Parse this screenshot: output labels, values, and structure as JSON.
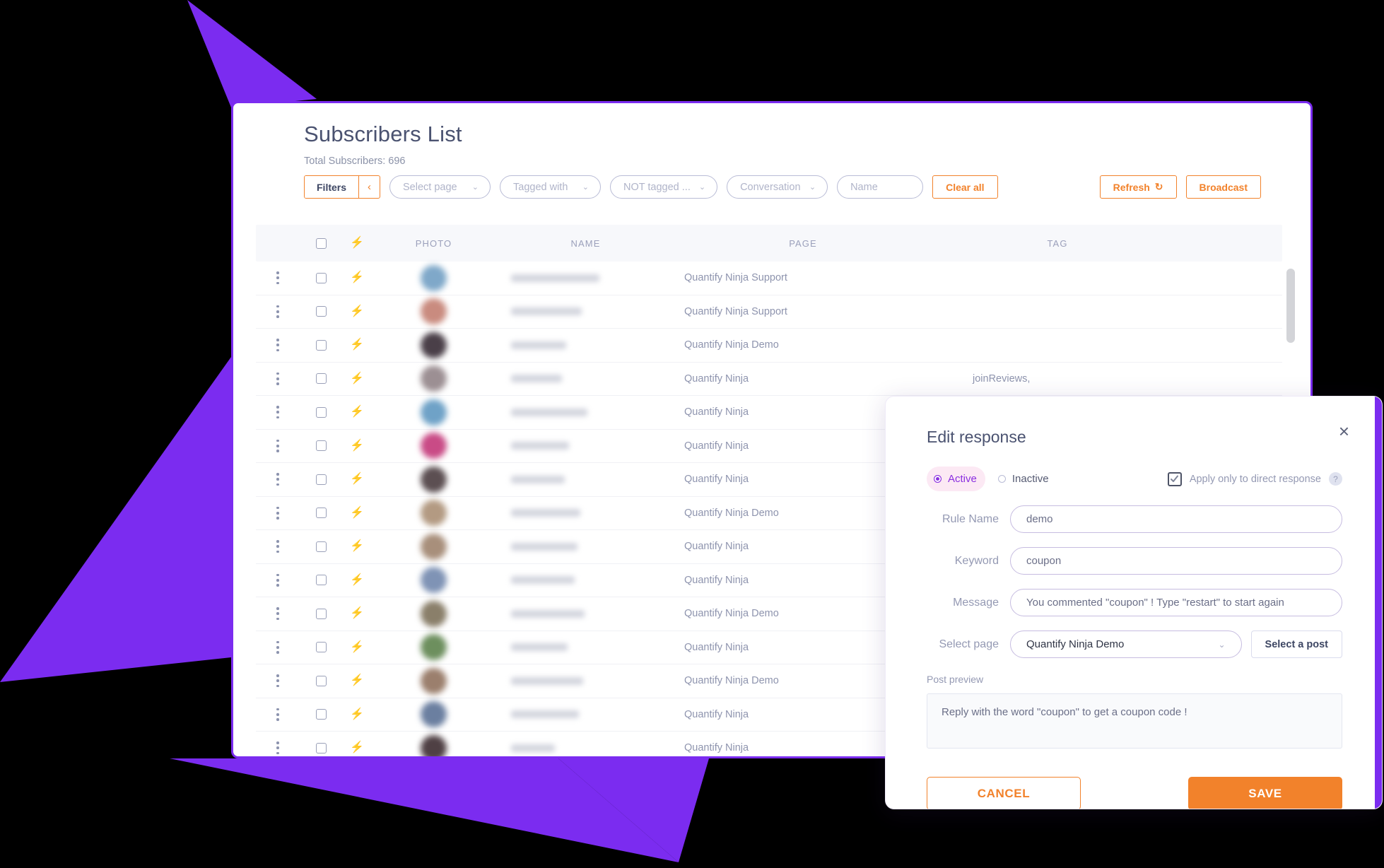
{
  "theme": {
    "accent_purple": "#7B2CF0",
    "accent_orange": "#F2822B",
    "radio_purple": "#8B2FE0",
    "background": "#000000"
  },
  "page": {
    "title": "Subscribers List",
    "total_subscribers_label": "Total Subscribers: 696"
  },
  "toolbar": {
    "filters_label": "Filters",
    "collapse_icon": "‹",
    "select_page_placeholder": "Select page",
    "tagged_with_placeholder": "Tagged with",
    "not_tagged_placeholder": "NOT tagged ...",
    "conversation_placeholder": "Conversation",
    "name_placeholder": "Name",
    "clear_all_label": "Clear all",
    "refresh_label": "Refresh",
    "refresh_icon": "↻",
    "broadcast_label": "Broadcast",
    "chevron": "⌄"
  },
  "table": {
    "columns": [
      "PHOTO",
      "NAME",
      "PAGE",
      "TAG"
    ],
    "rows": [
      {
        "page": "Quantify Ninja Support",
        "tag": "",
        "name_width": 125
      },
      {
        "page": "Quantify Ninja Support",
        "tag": "",
        "name_width": 100
      },
      {
        "page": "Quantify Ninja Demo",
        "tag": "",
        "name_width": 78
      },
      {
        "page": "Quantify Ninja",
        "tag": "joinReviews,",
        "name_width": 72
      },
      {
        "page": "Quantify Ninja",
        "tag": "",
        "name_width": 108
      },
      {
        "page": "Quantify Ninja",
        "tag": "",
        "name_width": 82
      },
      {
        "page": "Quantify Ninja",
        "tag": "",
        "name_width": 76
      },
      {
        "page": "Quantify Ninja Demo",
        "tag": "",
        "name_width": 98
      },
      {
        "page": "Quantify Ninja",
        "tag": "",
        "name_width": 94
      },
      {
        "page": "Quantify Ninja",
        "tag": "",
        "name_width": 90
      },
      {
        "page": "Quantify Ninja Demo",
        "tag": "",
        "name_width": 104
      },
      {
        "page": "Quantify Ninja",
        "tag": "",
        "name_width": 80
      },
      {
        "page": "Quantify Ninja Demo",
        "tag": "",
        "name_width": 102
      },
      {
        "page": "Quantify Ninja",
        "tag": "",
        "name_width": 96
      },
      {
        "page": "Quantify Ninja",
        "tag": "",
        "name_width": 62
      }
    ]
  },
  "modal": {
    "title": "Edit response",
    "close_icon": "×",
    "status": {
      "active_label": "Active",
      "inactive_label": "Inactive",
      "selected": "Active"
    },
    "apply_direct": {
      "label": "Apply only to direct response",
      "checked": true,
      "help_icon": "?"
    },
    "fields": {
      "rule_name_label": "Rule Name",
      "rule_name_value": "demo",
      "keyword_label": "Keyword",
      "keyword_value": "coupon",
      "message_label": "Message",
      "message_value": "You commented \"coupon\" ! Type \"restart\" to start again",
      "select_page_label": "Select page",
      "select_page_value": "Quantify Ninja Demo",
      "select_page_chevron": "⌄",
      "select_post_label": "Select a post"
    },
    "post_preview_label": "Post preview",
    "post_preview_text": "Reply with the word \"coupon\" to get a coupon code !",
    "cancel_label": "CANCEL",
    "save_label": "SAVE"
  }
}
